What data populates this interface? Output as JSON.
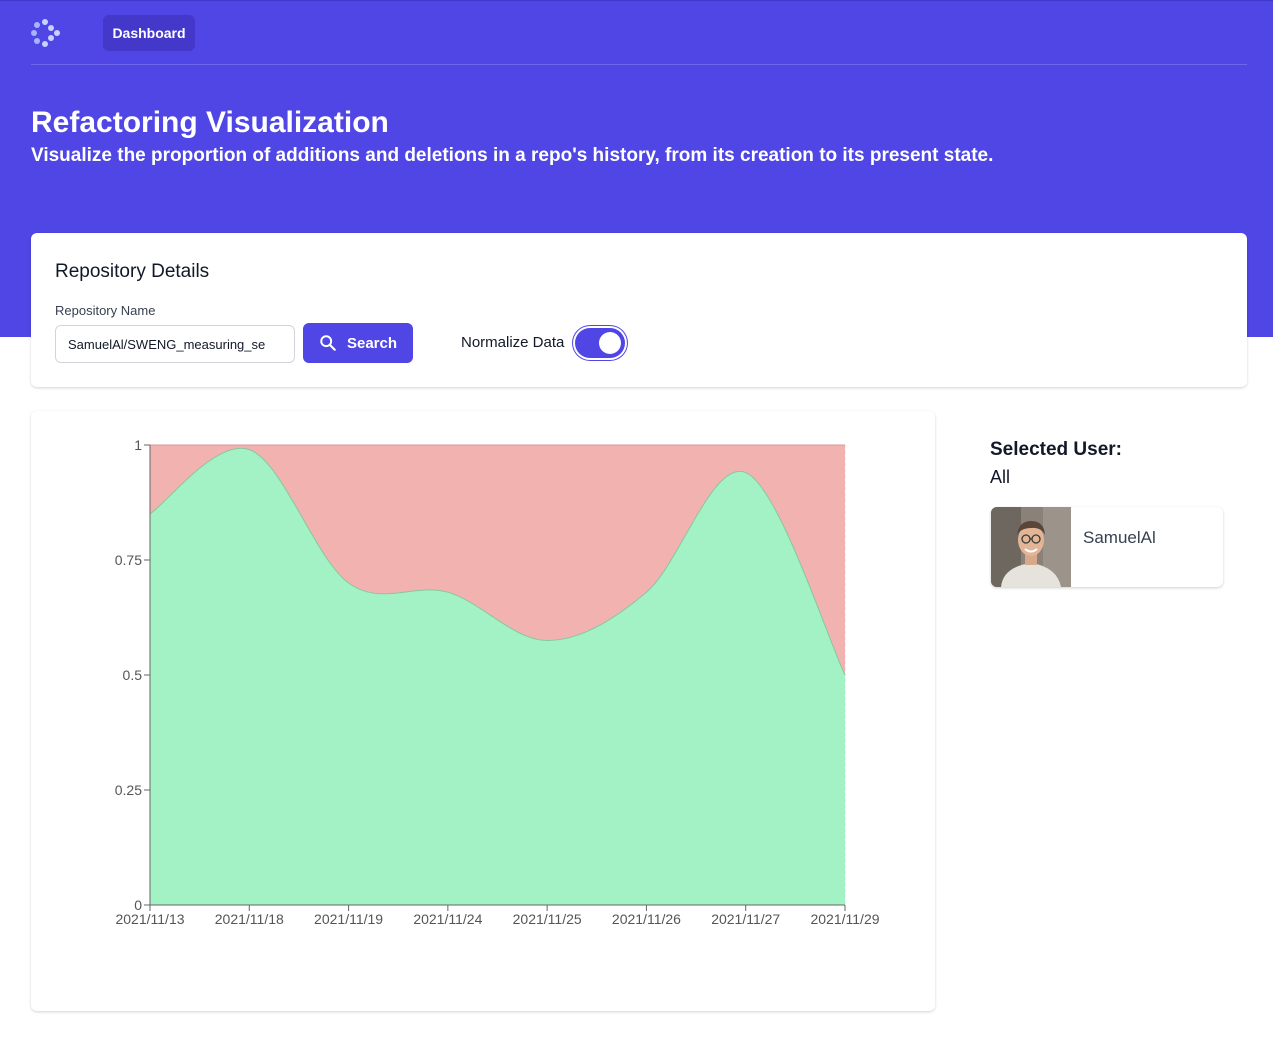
{
  "nav": {
    "logo_icon": "dots-chevron-logo",
    "dashboard_label": "Dashboard"
  },
  "header": {
    "title": "Refactoring Visualization",
    "subtitle": "Visualize the proportion of additions and deletions in a repo's history, from its creation to its present state."
  },
  "repo_details": {
    "title": "Repository Details",
    "repo_label": "Repository Name",
    "repo_value": "SamuelAl/SWENG_measuring_se",
    "search_label": "Search",
    "search_icon": "search-icon",
    "normalize_label": "Normalize Data",
    "normalize_on": true
  },
  "selected_user": {
    "title": "Selected User:",
    "value": "All",
    "users": [
      {
        "name": "SamuelAl"
      }
    ]
  },
  "colors": {
    "brand": "#4f46e5",
    "additions": "#a3f2c5",
    "deletions": "#f2b3b0"
  },
  "chart_data": {
    "type": "area",
    "stacked": true,
    "normalized": true,
    "x": [
      "2021/11/13",
      "2021/11/18",
      "2021/11/19",
      "2021/11/24",
      "2021/11/25",
      "2021/11/26",
      "2021/11/27",
      "2021/11/29"
    ],
    "series": [
      {
        "key": "additions",
        "values": [
          0.85,
          0.99,
          0.7,
          0.68,
          0.575,
          0.68,
          0.94,
          0.5
        ],
        "color": "#a3f2c5"
      },
      {
        "key": "deletions",
        "values": [
          0.15,
          0.01,
          0.3,
          0.32,
          0.425,
          0.32,
          0.06,
          0.5
        ],
        "color": "#f2b3b0"
      }
    ],
    "yticks": [
      "0",
      "0.25",
      "0.5",
      "0.75",
      "1"
    ],
    "ylim": [
      0,
      1
    ],
    "grid": true,
    "xlabel": "",
    "ylabel": ""
  }
}
